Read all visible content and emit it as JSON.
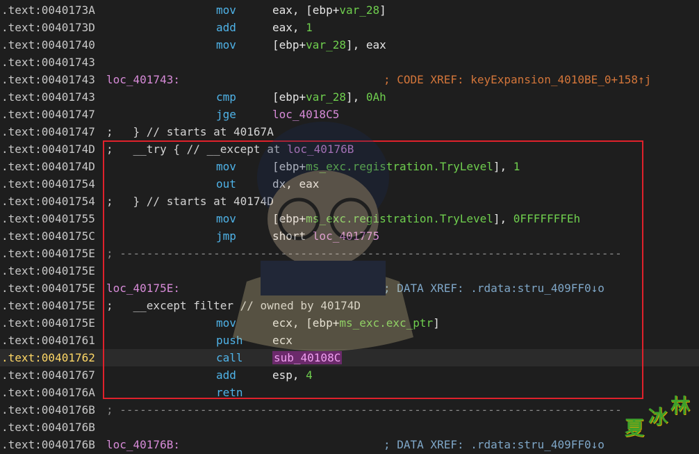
{
  "listing": [
    {
      "addr": ".text:0040173A",
      "mnemonic": "mov",
      "operands": [
        {
          "t": "eax, [ebp+"
        },
        {
          "t": "var_28",
          "c": "var"
        },
        {
          "t": "]"
        }
      ]
    },
    {
      "addr": ".text:0040173D",
      "mnemonic": "add",
      "operands": [
        {
          "t": "eax, "
        },
        {
          "t": "1",
          "c": "num"
        }
      ]
    },
    {
      "addr": ".text:00401740",
      "mnemonic": "mov",
      "operands": [
        {
          "t": "[ebp+"
        },
        {
          "t": "var_28",
          "c": "var"
        },
        {
          "t": "], eax"
        }
      ]
    },
    {
      "addr": ".text:00401743"
    },
    {
      "addr": ".text:00401743",
      "label": "loc_401743:",
      "xref": "; CODE XREF: keyExpansion_4010BE_0+158↑j",
      "xref_type": "code"
    },
    {
      "addr": ".text:00401743",
      "mnemonic": "cmp",
      "operands": [
        {
          "t": "[ebp+"
        },
        {
          "t": "var_28",
          "c": "var"
        },
        {
          "t": "], "
        },
        {
          "t": "0Ah",
          "c": "num"
        }
      ]
    },
    {
      "addr": ".text:00401747",
      "mnemonic": "jge",
      "operands": [
        {
          "t": "loc_4018C5",
          "c": "lbl"
        }
      ]
    },
    {
      "addr": ".text:00401747",
      "comment": [
        {
          "t": ";   } // starts at 40167A"
        }
      ]
    },
    {
      "addr": ".text:0040174D",
      "comment": [
        {
          "t": ";   __try { // __except at "
        },
        {
          "t": "loc_40176B",
          "c": "lbl"
        }
      ]
    },
    {
      "addr": ".text:0040174D",
      "mnemonic": "mov",
      "operands": [
        {
          "t": "[ebp+"
        },
        {
          "t": "ms_exc.registration.TryLevel",
          "c": "var"
        },
        {
          "t": "], "
        },
        {
          "t": "1",
          "c": "num"
        }
      ]
    },
    {
      "addr": ".text:00401754",
      "mnemonic": "out",
      "operands": [
        {
          "t": "dx, eax"
        }
      ]
    },
    {
      "addr": ".text:00401754",
      "comment": [
        {
          "t": ";   } // starts at 40174D"
        }
      ]
    },
    {
      "addr": ".text:00401755",
      "mnemonic": "mov",
      "operands": [
        {
          "t": "[ebp+"
        },
        {
          "t": "ms_exc.registration.TryLevel",
          "c": "var"
        },
        {
          "t": "], "
        },
        {
          "t": "0FFFFFFFEh",
          "c": "num"
        }
      ]
    },
    {
      "addr": ".text:0040175C",
      "mnemonic": "jmp",
      "operands": [
        {
          "t": "short ",
          "c": "kw"
        },
        {
          "t": "loc_401775",
          "c": "lbl"
        }
      ]
    },
    {
      "addr": ".text:0040175E",
      "separator": "; ---------------------------------------------------------------------------"
    },
    {
      "addr": ".text:0040175E"
    },
    {
      "addr": ".text:0040175E",
      "label": "loc_40175E:",
      "xref": "; DATA XREF: .rdata:stru_409FF0↓o",
      "xref_type": "data"
    },
    {
      "addr": ".text:0040175E",
      "comment": [
        {
          "t": ";   __except filter // owned by 40174D"
        }
      ]
    },
    {
      "addr": ".text:0040175E",
      "mnemonic": "mov",
      "operands": [
        {
          "t": "ecx, [ebp+"
        },
        {
          "t": "ms_exc.exc_ptr",
          "c": "var"
        },
        {
          "t": "]"
        }
      ]
    },
    {
      "addr": ".text:00401761",
      "mnemonic": "push",
      "operands": [
        {
          "t": "ecx"
        }
      ]
    },
    {
      "addr": ".text:00401762",
      "mnemonic": "call",
      "operands": [
        {
          "t": "sub_40108C",
          "c": "hlsub"
        }
      ],
      "current": true
    },
    {
      "addr": ".text:00401767",
      "mnemonic": "add",
      "operands": [
        {
          "t": "esp, "
        },
        {
          "t": "4",
          "c": "num"
        }
      ]
    },
    {
      "addr": ".text:0040176A",
      "mnemonic": "retn"
    },
    {
      "addr": ".text:0040176B",
      "separator": "; ---------------------------------------------------------------------------"
    },
    {
      "addr": ".text:0040176B"
    },
    {
      "addr": ".text:0040176B",
      "label": "loc_40176B:",
      "xref": "; DATA XREF: .rdata:stru_409FF0↓o",
      "xref_type": "data"
    }
  ],
  "watermark": {
    "figure": "anime-character-illustration",
    "stamp_text": "夏冰林"
  },
  "colors": {
    "background": "#1e1e1e",
    "address": "#c8c8c8",
    "current_address": "#ffd866",
    "mnemonic": "#4fb3e8",
    "label": "#d78bd8",
    "variable": "#6fcf4e",
    "code_xref": "#d4763a",
    "data_xref": "#7fa7c8",
    "highlight_box": "#e0212b"
  }
}
